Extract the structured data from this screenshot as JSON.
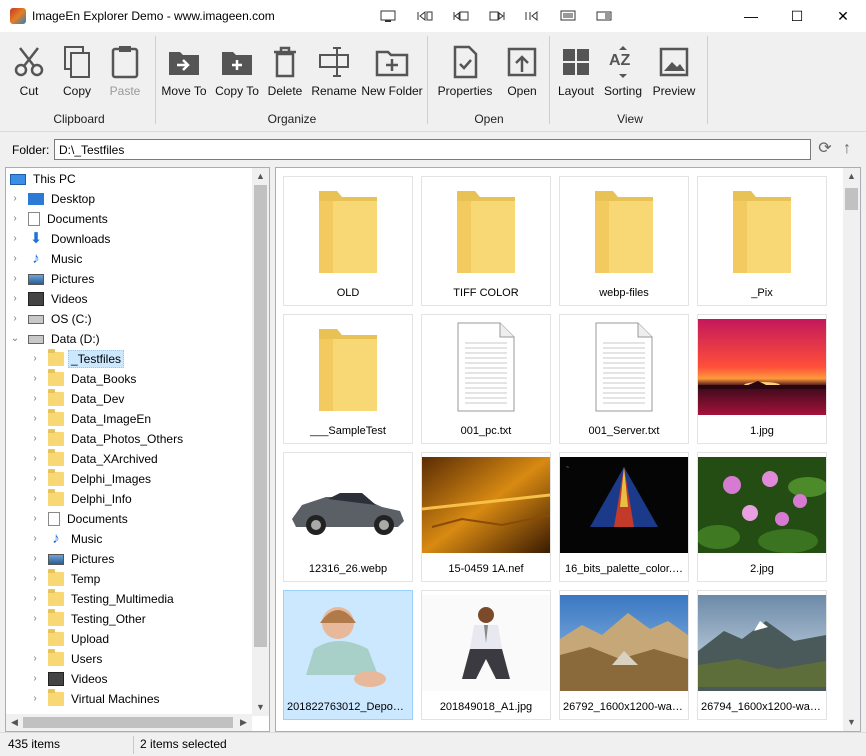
{
  "window": {
    "title": "ImageEn Explorer Demo - www.imageen.com",
    "title_tools": [
      "display-icon",
      "nav-first-icon",
      "nav-prev-icon",
      "nav-next-icon",
      "nav-last-icon",
      "monitor-icon",
      "fullscreen-icon"
    ],
    "controls": {
      "minimize": "—",
      "maximize": "☐",
      "close": "✕"
    }
  },
  "ribbon": {
    "groups": [
      {
        "label": "Clipboard",
        "buttons": [
          {
            "label": "Cut",
            "icon": "scissors-icon"
          },
          {
            "label": "Copy",
            "icon": "copy-icon"
          },
          {
            "label": "Paste",
            "icon": "paste-icon",
            "disabled": true
          }
        ]
      },
      {
        "label": "Organize",
        "buttons": [
          {
            "label": "Move To",
            "icon": "move-to-icon"
          },
          {
            "label": "Copy To",
            "icon": "copy-to-icon"
          },
          {
            "label": "Delete",
            "icon": "trash-icon"
          },
          {
            "label": "Rename",
            "icon": "rename-icon"
          },
          {
            "label": "New Folder",
            "icon": "new-folder-icon"
          }
        ]
      },
      {
        "label": "Open",
        "buttons": [
          {
            "label": "Properties",
            "icon": "properties-icon"
          },
          {
            "label": "Open",
            "icon": "open-icon"
          }
        ]
      },
      {
        "label": "View",
        "buttons": [
          {
            "label": "Layout",
            "icon": "layout-icon"
          },
          {
            "label": "Sorting",
            "icon": "sort-az-icon"
          },
          {
            "label": "Preview",
            "icon": "preview-icon"
          }
        ]
      }
    ]
  },
  "folder_bar": {
    "label": "Folder:",
    "value": "D:\\_Testfiles"
  },
  "tree": {
    "items": [
      {
        "label": "This PC",
        "icon": "pc",
        "level": 0,
        "expander": ""
      },
      {
        "label": "Desktop",
        "icon": "desk",
        "level": 1,
        "expander": ">"
      },
      {
        "label": "Documents",
        "icon": "doc",
        "level": 1,
        "expander": ">"
      },
      {
        "label": "Downloads",
        "icon": "down",
        "level": 1,
        "expander": ">"
      },
      {
        "label": "Music",
        "icon": "music",
        "level": 1,
        "expander": ">"
      },
      {
        "label": "Pictures",
        "icon": "pic",
        "level": 1,
        "expander": ">"
      },
      {
        "label": "Videos",
        "icon": "vid",
        "level": 1,
        "expander": ">"
      },
      {
        "label": "OS (C:)",
        "icon": "drive",
        "level": 1,
        "expander": ">"
      },
      {
        "label": "Data (D:)",
        "icon": "drive",
        "level": 1,
        "expander": "v"
      },
      {
        "label": "_Testfiles",
        "icon": "folder",
        "level": 2,
        "expander": ">",
        "selected": true
      },
      {
        "label": "Data_Books",
        "icon": "folder",
        "level": 2,
        "expander": ">"
      },
      {
        "label": "Data_Dev",
        "icon": "folder",
        "level": 2,
        "expander": ">"
      },
      {
        "label": "Data_ImageEn",
        "icon": "folder",
        "level": 2,
        "expander": ">"
      },
      {
        "label": "Data_Photos_Others",
        "icon": "folder",
        "level": 2,
        "expander": ">"
      },
      {
        "label": "Data_XArchived",
        "icon": "folder",
        "level": 2,
        "expander": ">"
      },
      {
        "label": "Delphi_Images",
        "icon": "folder",
        "level": 2,
        "expander": ">"
      },
      {
        "label": "Delphi_Info",
        "icon": "folder",
        "level": 2,
        "expander": ">"
      },
      {
        "label": "Documents",
        "icon": "doc",
        "level": 2,
        "expander": ">"
      },
      {
        "label": "Music",
        "icon": "music",
        "level": 2,
        "expander": ">"
      },
      {
        "label": "Pictures",
        "icon": "pic",
        "level": 2,
        "expander": ">"
      },
      {
        "label": "Temp",
        "icon": "folder",
        "level": 2,
        "expander": ">"
      },
      {
        "label": "Testing_Multimedia",
        "icon": "folder",
        "level": 2,
        "expander": ">"
      },
      {
        "label": "Testing_Other",
        "icon": "folder",
        "level": 2,
        "expander": ">"
      },
      {
        "label": "Upload",
        "icon": "folder",
        "level": 2,
        "expander": ""
      },
      {
        "label": "Users",
        "icon": "folder",
        "level": 2,
        "expander": ">"
      },
      {
        "label": "Videos",
        "icon": "vid",
        "level": 2,
        "expander": ">"
      },
      {
        "label": "Virtual Machines",
        "icon": "folder",
        "level": 2,
        "expander": ">"
      }
    ]
  },
  "files": [
    {
      "name": "OLD",
      "kind": "folder"
    },
    {
      "name": "TIFF COLOR",
      "kind": "folder"
    },
    {
      "name": "webp-files",
      "kind": "folder"
    },
    {
      "name": "_Pix",
      "kind": "folder"
    },
    {
      "name": "___SampleTest",
      "kind": "folder"
    },
    {
      "name": "001_pc.txt",
      "kind": "text"
    },
    {
      "name": "001_Server.txt",
      "kind": "text"
    },
    {
      "name": "1.jpg",
      "kind": "image",
      "art": "sunset"
    },
    {
      "name": "12316_26.webp",
      "kind": "image",
      "art": "car"
    },
    {
      "name": "15-0459 1A.nef",
      "kind": "image",
      "art": "fire"
    },
    {
      "name": "16_bits_palette_color.…",
      "kind": "image",
      "art": "scan"
    },
    {
      "name": "2.jpg",
      "kind": "image",
      "art": "lotus"
    },
    {
      "name": "201822763012_Deposi…",
      "kind": "image",
      "art": "baby",
      "selected": true
    },
    {
      "name": "201849018_A1.jpg",
      "kind": "image",
      "art": "man"
    },
    {
      "name": "26792_1600x1200-wal…",
      "kind": "image",
      "art": "mountain1"
    },
    {
      "name": "26794_1600x1200-wal…",
      "kind": "image",
      "art": "mountain2"
    }
  ],
  "status": {
    "items_count": "435 items",
    "selected_count": "2 items selected"
  },
  "colors": {
    "selection": "#cce8ff",
    "folder": "#f8d775",
    "accent": "#0078d7"
  }
}
